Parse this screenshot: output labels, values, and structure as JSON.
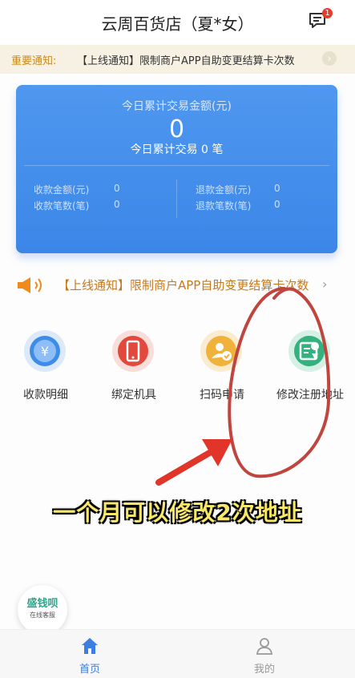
{
  "header": {
    "title": "云周百货店（夏*女）",
    "badge_count": "1",
    "icon": "message-icon"
  },
  "notice": {
    "label": "重要通知:",
    "text": "【上线通知】限制商户APP自助变更结算卡次数"
  },
  "card": {
    "label": "今日累计交易金额(元)",
    "amount": "0",
    "count_text": "今日累计交易 0 笔",
    "stats": {
      "collect_amount_label": "收款金额(元)",
      "collect_amount_value": "0",
      "collect_count_label": "收款笔数(笔)",
      "collect_count_value": "0",
      "refund_amount_label": "退款金额(元)",
      "refund_amount_value": "0",
      "refund_count_label": "退款笔数(笔)",
      "refund_count_value": "0"
    },
    "color": "#4a92ec"
  },
  "marquee": {
    "text": "【上线通知】限制商户APP自助变更结算卡次数",
    "icon": "speaker-icon"
  },
  "grid": [
    {
      "label": "收款明细",
      "icon": "yuan-coin-icon",
      "color": "#3d8de8"
    },
    {
      "label": "绑定机具",
      "icon": "phone-icon",
      "color": "#e2483c"
    },
    {
      "label": "扫码申请",
      "icon": "user-check-icon",
      "color": "#f1b23b"
    },
    {
      "label": "修改注册地址",
      "icon": "map-card-icon",
      "color": "#33b27d"
    }
  ],
  "annotation": {
    "text": "一个月可以修改2次地址"
  },
  "chat": {
    "brand": "盛钱呗",
    "sub": "在线客服"
  },
  "tabs": [
    {
      "label": "首页",
      "icon": "home-icon",
      "active": true
    },
    {
      "label": "我的",
      "icon": "user-icon",
      "active": false
    }
  ]
}
